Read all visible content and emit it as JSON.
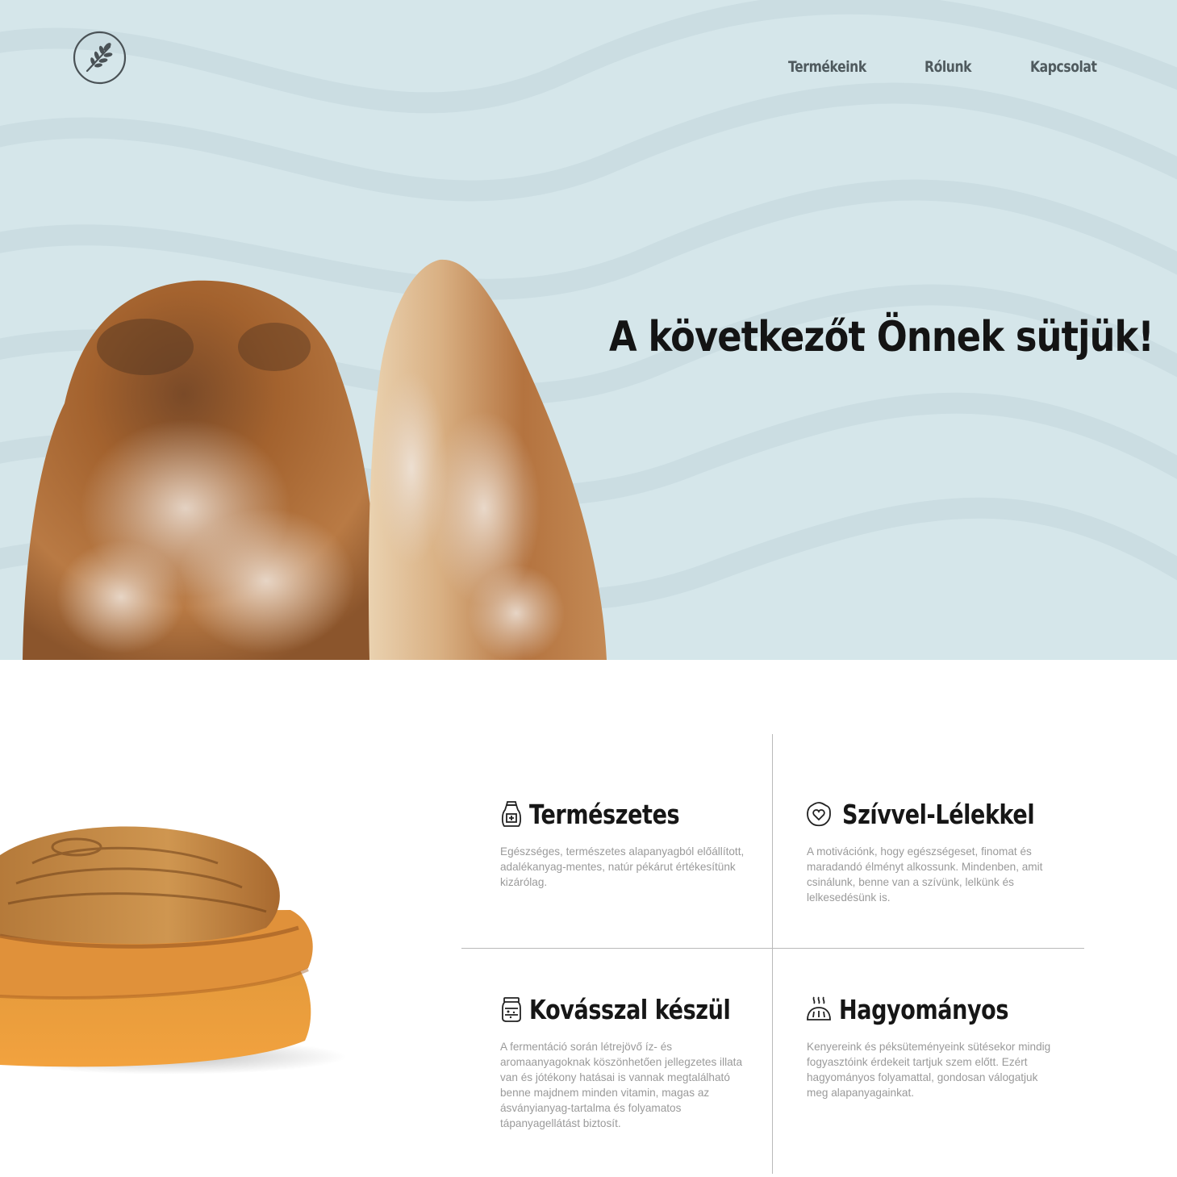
{
  "nav": {
    "items": [
      {
        "label": "Termékeink"
      },
      {
        "label": "Rólunk"
      },
      {
        "label": "Kapcsolat"
      }
    ]
  },
  "logo": {
    "icon": "wheat-icon"
  },
  "hero": {
    "title": "A következőt Önnek sütjük!",
    "image": "bread-loaves-image"
  },
  "features": [
    {
      "icon": "flour-sack-icon",
      "title": "Természetes",
      "text": "Egészséges, természetes alapanyagból előállított, adalékanyag-mentes, natúr pékárut értékesítünk kizárólag."
    },
    {
      "icon": "heart-cookie-icon",
      "title": "Szívvel-Lélekkel",
      "text": "A motivációnk, hogy egészségeset, finomat és maradandó élményt alkossunk. Mindenben, amit csinálunk, benne van a szívünk, lelkünk és lelkesedésünk is."
    },
    {
      "icon": "sourdough-jar-icon",
      "title": "Kovásszal készül",
      "text": "A fermentáció során létrejövő íz- és aromaanyagoknak köszönhetően jellegzetes illata van és jótékony hatásai is vannak megtalálható benne majdnem minden vitamin, magas az ásványianyag-tartalma és folyamatos tápanyagellátást biztosít."
    },
    {
      "icon": "baked-bread-icon",
      "title": "Hagyományos",
      "text": "Kenyereink és péksüteményeink sütésekor mindig fogyasztóink érdekeit tartjuk szem előtt. Ezért hagyományos folyamattal, gondosan válogatjuk meg alapanyagainkat."
    }
  ],
  "colors": {
    "hero_background": "#d5e6ea",
    "heading": "#161616",
    "nav_text": "#4f5a5e",
    "body_text": "#9a9a9a"
  }
}
